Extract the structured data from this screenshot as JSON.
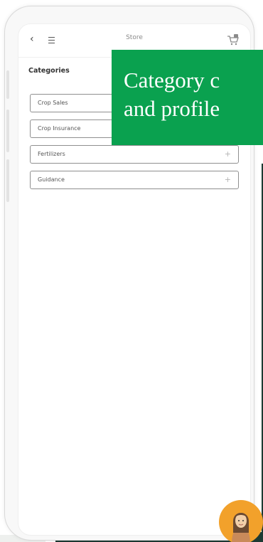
{
  "appbar": {
    "title": "Store",
    "back_icon": "chevron-left-icon",
    "menu_icon": "hamburger-icon",
    "cart_icon": "cart-icon"
  },
  "categories": {
    "heading": "Categories",
    "items": [
      {
        "label": "Crop Sales",
        "icon": "plus-icon"
      },
      {
        "label": "Crop Insurance",
        "icon": "plus-icon"
      },
      {
        "label": "Fertilizers",
        "icon": "plus-icon"
      },
      {
        "label": "Guidance",
        "icon": "plus-icon"
      }
    ]
  },
  "overlay_caption": {
    "line1": "Category c",
    "line2": "and profile"
  },
  "colors": {
    "caption_bg": "#0aa14f",
    "avatar_bg": "#f2a12b",
    "backdrop": "#1d3a33"
  }
}
